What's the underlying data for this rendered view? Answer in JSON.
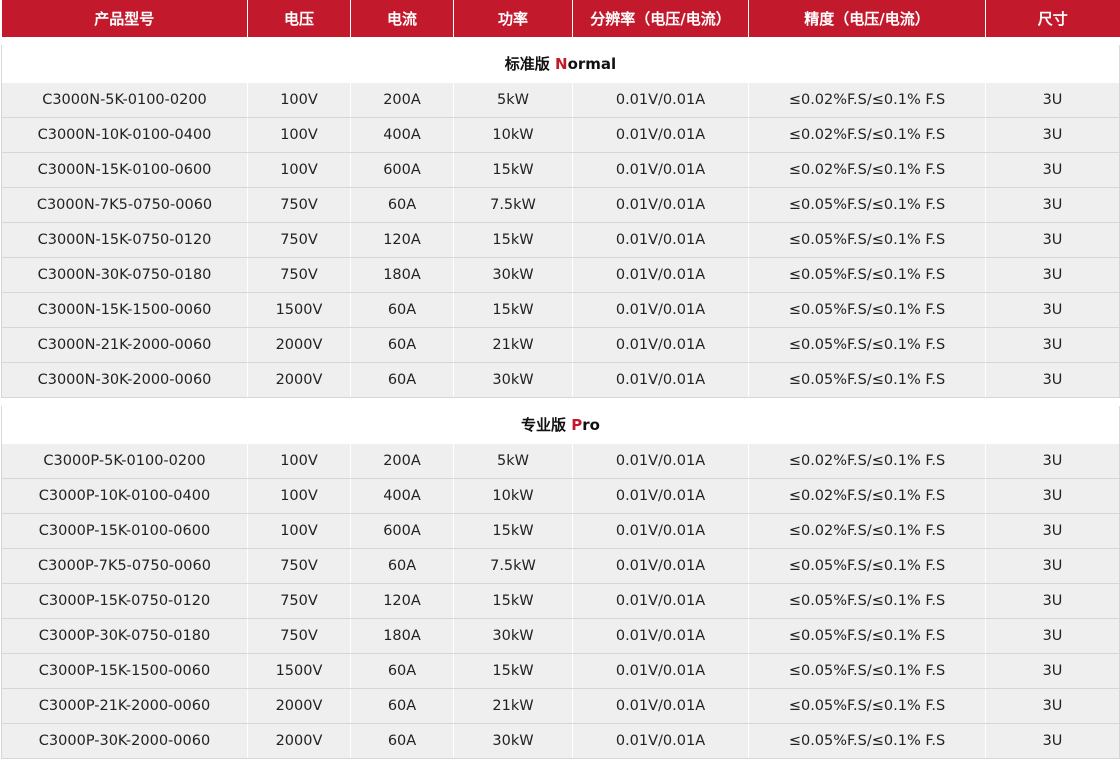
{
  "colors": {
    "header_bg": "#c3192d",
    "accent": "#c3192d",
    "row_bg": "#efefef"
  },
  "headers": [
    "产品型号",
    "电压",
    "电流",
    "功率",
    "分辨率（电压/电流）",
    "精度（电压/电流）",
    "尺寸"
  ],
  "sections": [
    {
      "title_cn": "标准版 ",
      "title_accent": "N",
      "title_rest": "ormal",
      "rows": [
        [
          "C3000N-5K-0100-0200",
          "100V",
          "200A",
          "5kW",
          "0.01V/0.01A",
          "≤0.02%F.S/≤0.1% F.S",
          "3U"
        ],
        [
          "C3000N-10K-0100-0400",
          "100V",
          "400A",
          "10kW",
          "0.01V/0.01A",
          "≤0.02%F.S/≤0.1% F.S",
          "3U"
        ],
        [
          "C3000N-15K-0100-0600",
          "100V",
          "600A",
          "15kW",
          "0.01V/0.01A",
          "≤0.02%F.S/≤0.1% F.S",
          "3U"
        ],
        [
          "C3000N-7K5-0750-0060",
          "750V",
          "60A",
          "7.5kW",
          "0.01V/0.01A",
          "≤0.05%F.S/≤0.1% F.S",
          "3U"
        ],
        [
          "C3000N-15K-0750-0120",
          "750V",
          "120A",
          "15kW",
          "0.01V/0.01A",
          "≤0.05%F.S/≤0.1% F.S",
          "3U"
        ],
        [
          "C3000N-30K-0750-0180",
          "750V",
          "180A",
          "30kW",
          "0.01V/0.01A",
          "≤0.05%F.S/≤0.1% F.S",
          "3U"
        ],
        [
          "C3000N-15K-1500-0060",
          "1500V",
          "60A",
          "15kW",
          "0.01V/0.01A",
          "≤0.05%F.S/≤0.1% F.S",
          "3U"
        ],
        [
          "C3000N-21K-2000-0060",
          "2000V",
          "60A",
          "21kW",
          "0.01V/0.01A",
          "≤0.05%F.S/≤0.1% F.S",
          "3U"
        ],
        [
          "C3000N-30K-2000-0060",
          "2000V",
          "60A",
          "30kW",
          "0.01V/0.01A",
          "≤0.05%F.S/≤0.1% F.S",
          "3U"
        ]
      ]
    },
    {
      "title_cn": "专业版 ",
      "title_accent": "P",
      "title_rest": "ro",
      "rows": [
        [
          "C3000P-5K-0100-0200",
          "100V",
          "200A",
          "5kW",
          "0.01V/0.01A",
          "≤0.02%F.S/≤0.1% F.S",
          "3U"
        ],
        [
          "C3000P-10K-0100-0400",
          "100V",
          "400A",
          "10kW",
          "0.01V/0.01A",
          "≤0.02%F.S/≤0.1% F.S",
          "3U"
        ],
        [
          "C3000P-15K-0100-0600",
          "100V",
          "600A",
          "15kW",
          "0.01V/0.01A",
          "≤0.02%F.S/≤0.1% F.S",
          "3U"
        ],
        [
          "C3000P-7K5-0750-0060",
          "750V",
          "60A",
          "7.5kW",
          "0.01V/0.01A",
          "≤0.05%F.S/≤0.1% F.S",
          "3U"
        ],
        [
          "C3000P-15K-0750-0120",
          "750V",
          "120A",
          "15kW",
          "0.01V/0.01A",
          "≤0.05%F.S/≤0.1% F.S",
          "3U"
        ],
        [
          "C3000P-30K-0750-0180",
          "750V",
          "180A",
          "30kW",
          "0.01V/0.01A",
          "≤0.05%F.S/≤0.1% F.S",
          "3U"
        ],
        [
          "C3000P-15K-1500-0060",
          "1500V",
          "60A",
          "15kW",
          "0.01V/0.01A",
          "≤0.05%F.S/≤0.1% F.S",
          "3U"
        ],
        [
          "C3000P-21K-2000-0060",
          "2000V",
          "60A",
          "21kW",
          "0.01V/0.01A",
          "≤0.05%F.S/≤0.1% F.S",
          "3U"
        ],
        [
          "C3000P-30K-2000-0060",
          "2000V",
          "60A",
          "30kW",
          "0.01V/0.01A",
          "≤0.05%F.S/≤0.1% F.S",
          "3U"
        ]
      ]
    }
  ]
}
